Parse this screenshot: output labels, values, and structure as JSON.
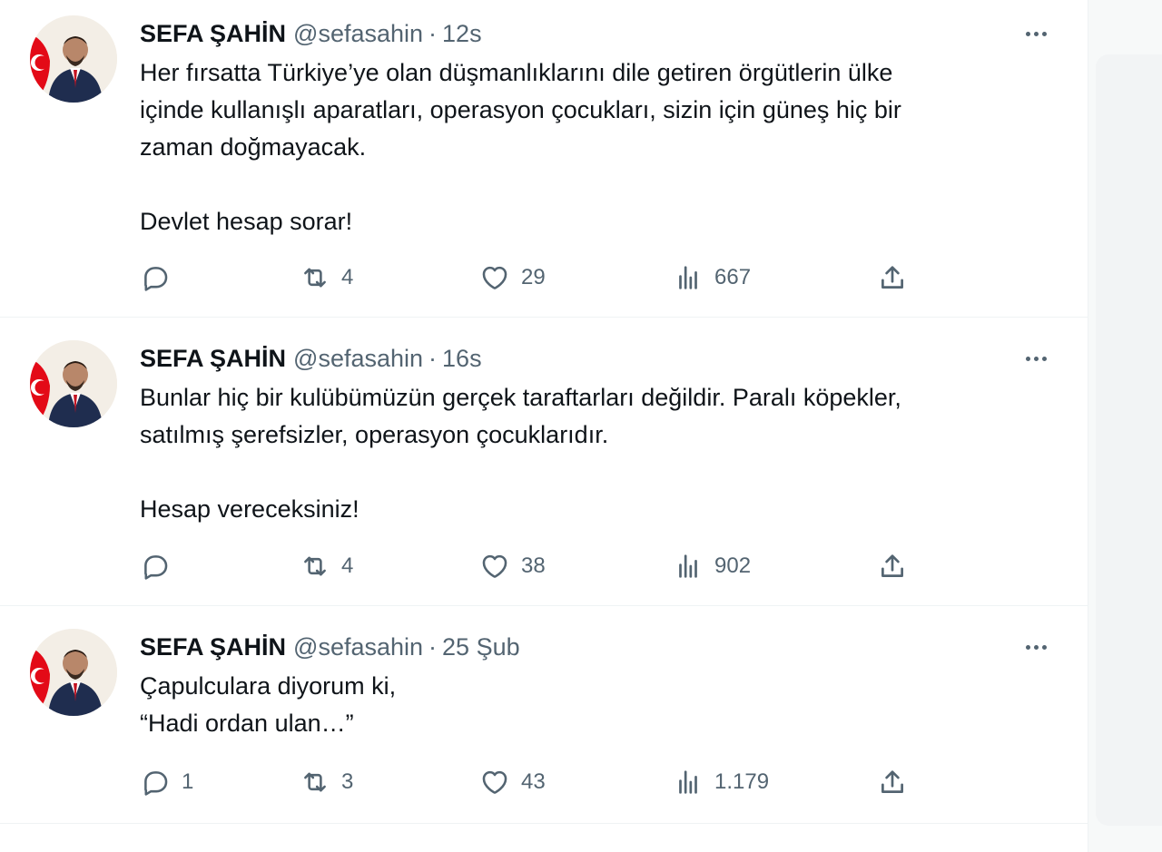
{
  "tweets": [
    {
      "name": "SEFA ŞAHİN",
      "handle": "@sefasahin",
      "separator": "·",
      "time": "12s",
      "lines": [
        "Her fırsatta Türkiye’ye olan düşmanlıklarını dile getiren örgütlerin ülke",
        "içinde kullanışlı aparatları, operasyon çocukları, sizin için güneş hiç bir",
        "zaman doğmayacak.",
        "",
        "Devlet hesap sorar!"
      ],
      "replies": "",
      "retweets": "4",
      "likes": "29",
      "views": "667"
    },
    {
      "name": "SEFA ŞAHİN",
      "handle": "@sefasahin",
      "separator": "·",
      "time": "16s",
      "lines": [
        "Bunlar hiç bir kulübümüzün gerçek taraftarları değildir. Paralı köpekler,",
        "satılmış şerefsizler, operasyon çocuklarıdır.",
        "",
        "Hesap vereceksiniz!"
      ],
      "replies": "",
      "retweets": "4",
      "likes": "38",
      "views": "902"
    },
    {
      "name": "SEFA ŞAHİN",
      "handle": "@sefasahin",
      "separator": "·",
      "time": "25 Şub",
      "lines": [
        "Çapulculara diyorum ki,",
        "“Hadi ordan ulan…”"
      ],
      "replies": "1",
      "retweets": "3",
      "likes": "43",
      "views": "1.179"
    }
  ],
  "icons": {
    "reply": "reply-icon",
    "retweet": "retweet-icon",
    "like": "heart-icon",
    "views": "views-icon",
    "share": "share-icon",
    "more": "more-icon"
  },
  "colors": {
    "text": "#0f1419",
    "secondary": "#536471",
    "divider": "#eff3f4",
    "flag_red": "#e30a17",
    "suit": "#1f2d4f"
  }
}
